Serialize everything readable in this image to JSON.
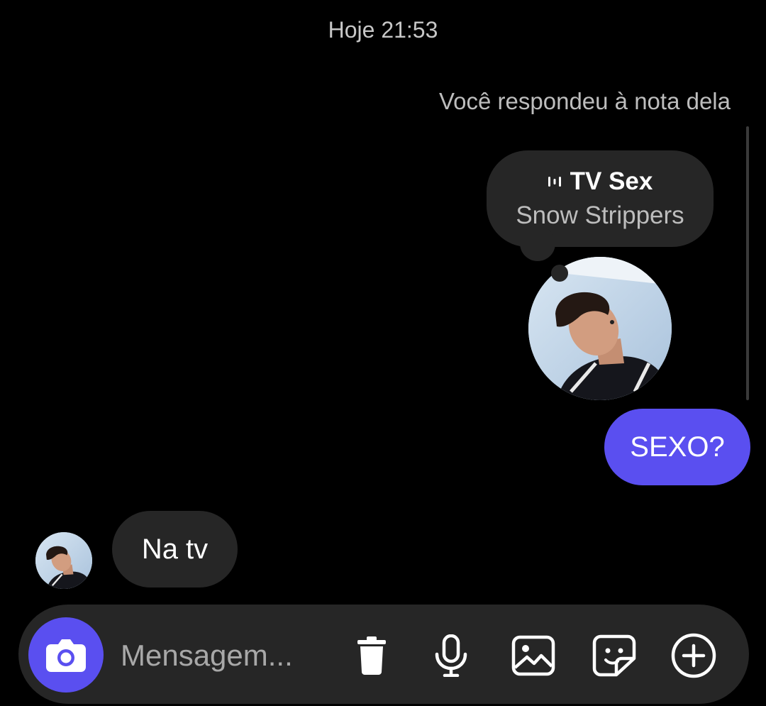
{
  "thread": {
    "timestamp": "Hoje 21:53",
    "reply_context": "Você respondeu à nota dela"
  },
  "note": {
    "music_icon": "audio-bars-icon",
    "title": "TV Sex",
    "subtitle": "Snow Strippers"
  },
  "messages": [
    {
      "direction": "sent",
      "text": "SEXO?"
    },
    {
      "direction": "received",
      "text": "Na tv"
    }
  ],
  "composer": {
    "placeholder": "Mensagem...",
    "value": "",
    "icons": [
      "camera-icon",
      "trash-icon",
      "microphone-icon",
      "gallery-icon",
      "sticker-icon",
      "plus-circle-icon"
    ]
  },
  "colors": {
    "background": "#000000",
    "sent_bubble": "#5a4ff0",
    "received_bubble": "#262626",
    "accent": "#5a4ff0"
  }
}
